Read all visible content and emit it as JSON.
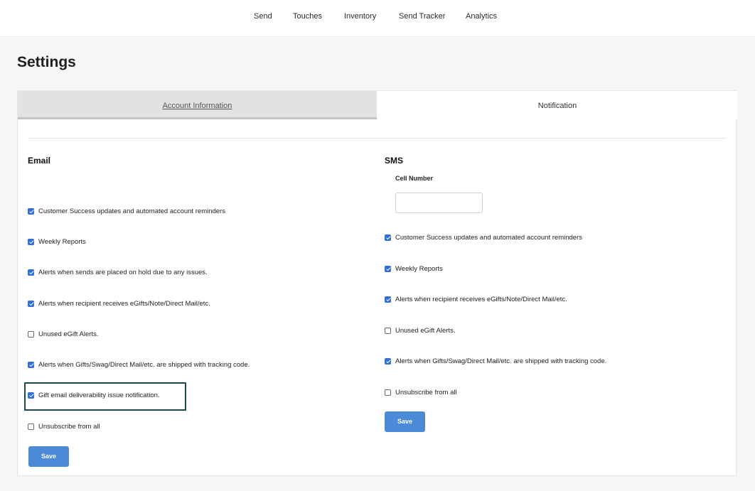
{
  "nav": {
    "items": [
      "Send",
      "Touches",
      "Inventory",
      "Send Tracker",
      "Analytics"
    ]
  },
  "page": {
    "title": "Settings"
  },
  "tabs": {
    "account": "Account Information",
    "notification": "Notification"
  },
  "email": {
    "heading": "Email",
    "options": [
      {
        "label": "Customer Success updates and automated account reminders",
        "checked": true
      },
      {
        "label": "Weekly Reports",
        "checked": true
      },
      {
        "label": "Alerts when sends are placed on hold due to any issues.",
        "checked": true
      },
      {
        "label": "Alerts when recipient receives eGifts/Note/Direct Mail/etc.",
        "checked": true
      },
      {
        "label": "Unused eGift Alerts.",
        "checked": false
      },
      {
        "label": "Alerts when Gifts/Swag/Direct Mail/etc. are shipped with tracking code.",
        "checked": true
      },
      {
        "label": "Gift email deliverability issue notification.",
        "checked": true
      },
      {
        "label": "Unsubscribe from all",
        "checked": false
      }
    ],
    "save_label": "Save"
  },
  "sms": {
    "heading": "SMS",
    "cell_label": "Cell Number",
    "cell_value": "",
    "options": [
      {
        "label": "Customer Success updates and automated account reminders",
        "checked": true
      },
      {
        "label": "Weekly Reports",
        "checked": true
      },
      {
        "label": "Alerts when recipient receives eGifts/Note/Direct Mail/etc.",
        "checked": true
      },
      {
        "label": "Unused eGift Alerts.",
        "checked": false
      },
      {
        "label": "Alerts when Gifts/Swag/Direct Mail/etc. are shipped with tracking code.",
        "checked": true
      },
      {
        "label": "Unsubscribe from all",
        "checked": false
      }
    ],
    "save_label": "Save"
  }
}
